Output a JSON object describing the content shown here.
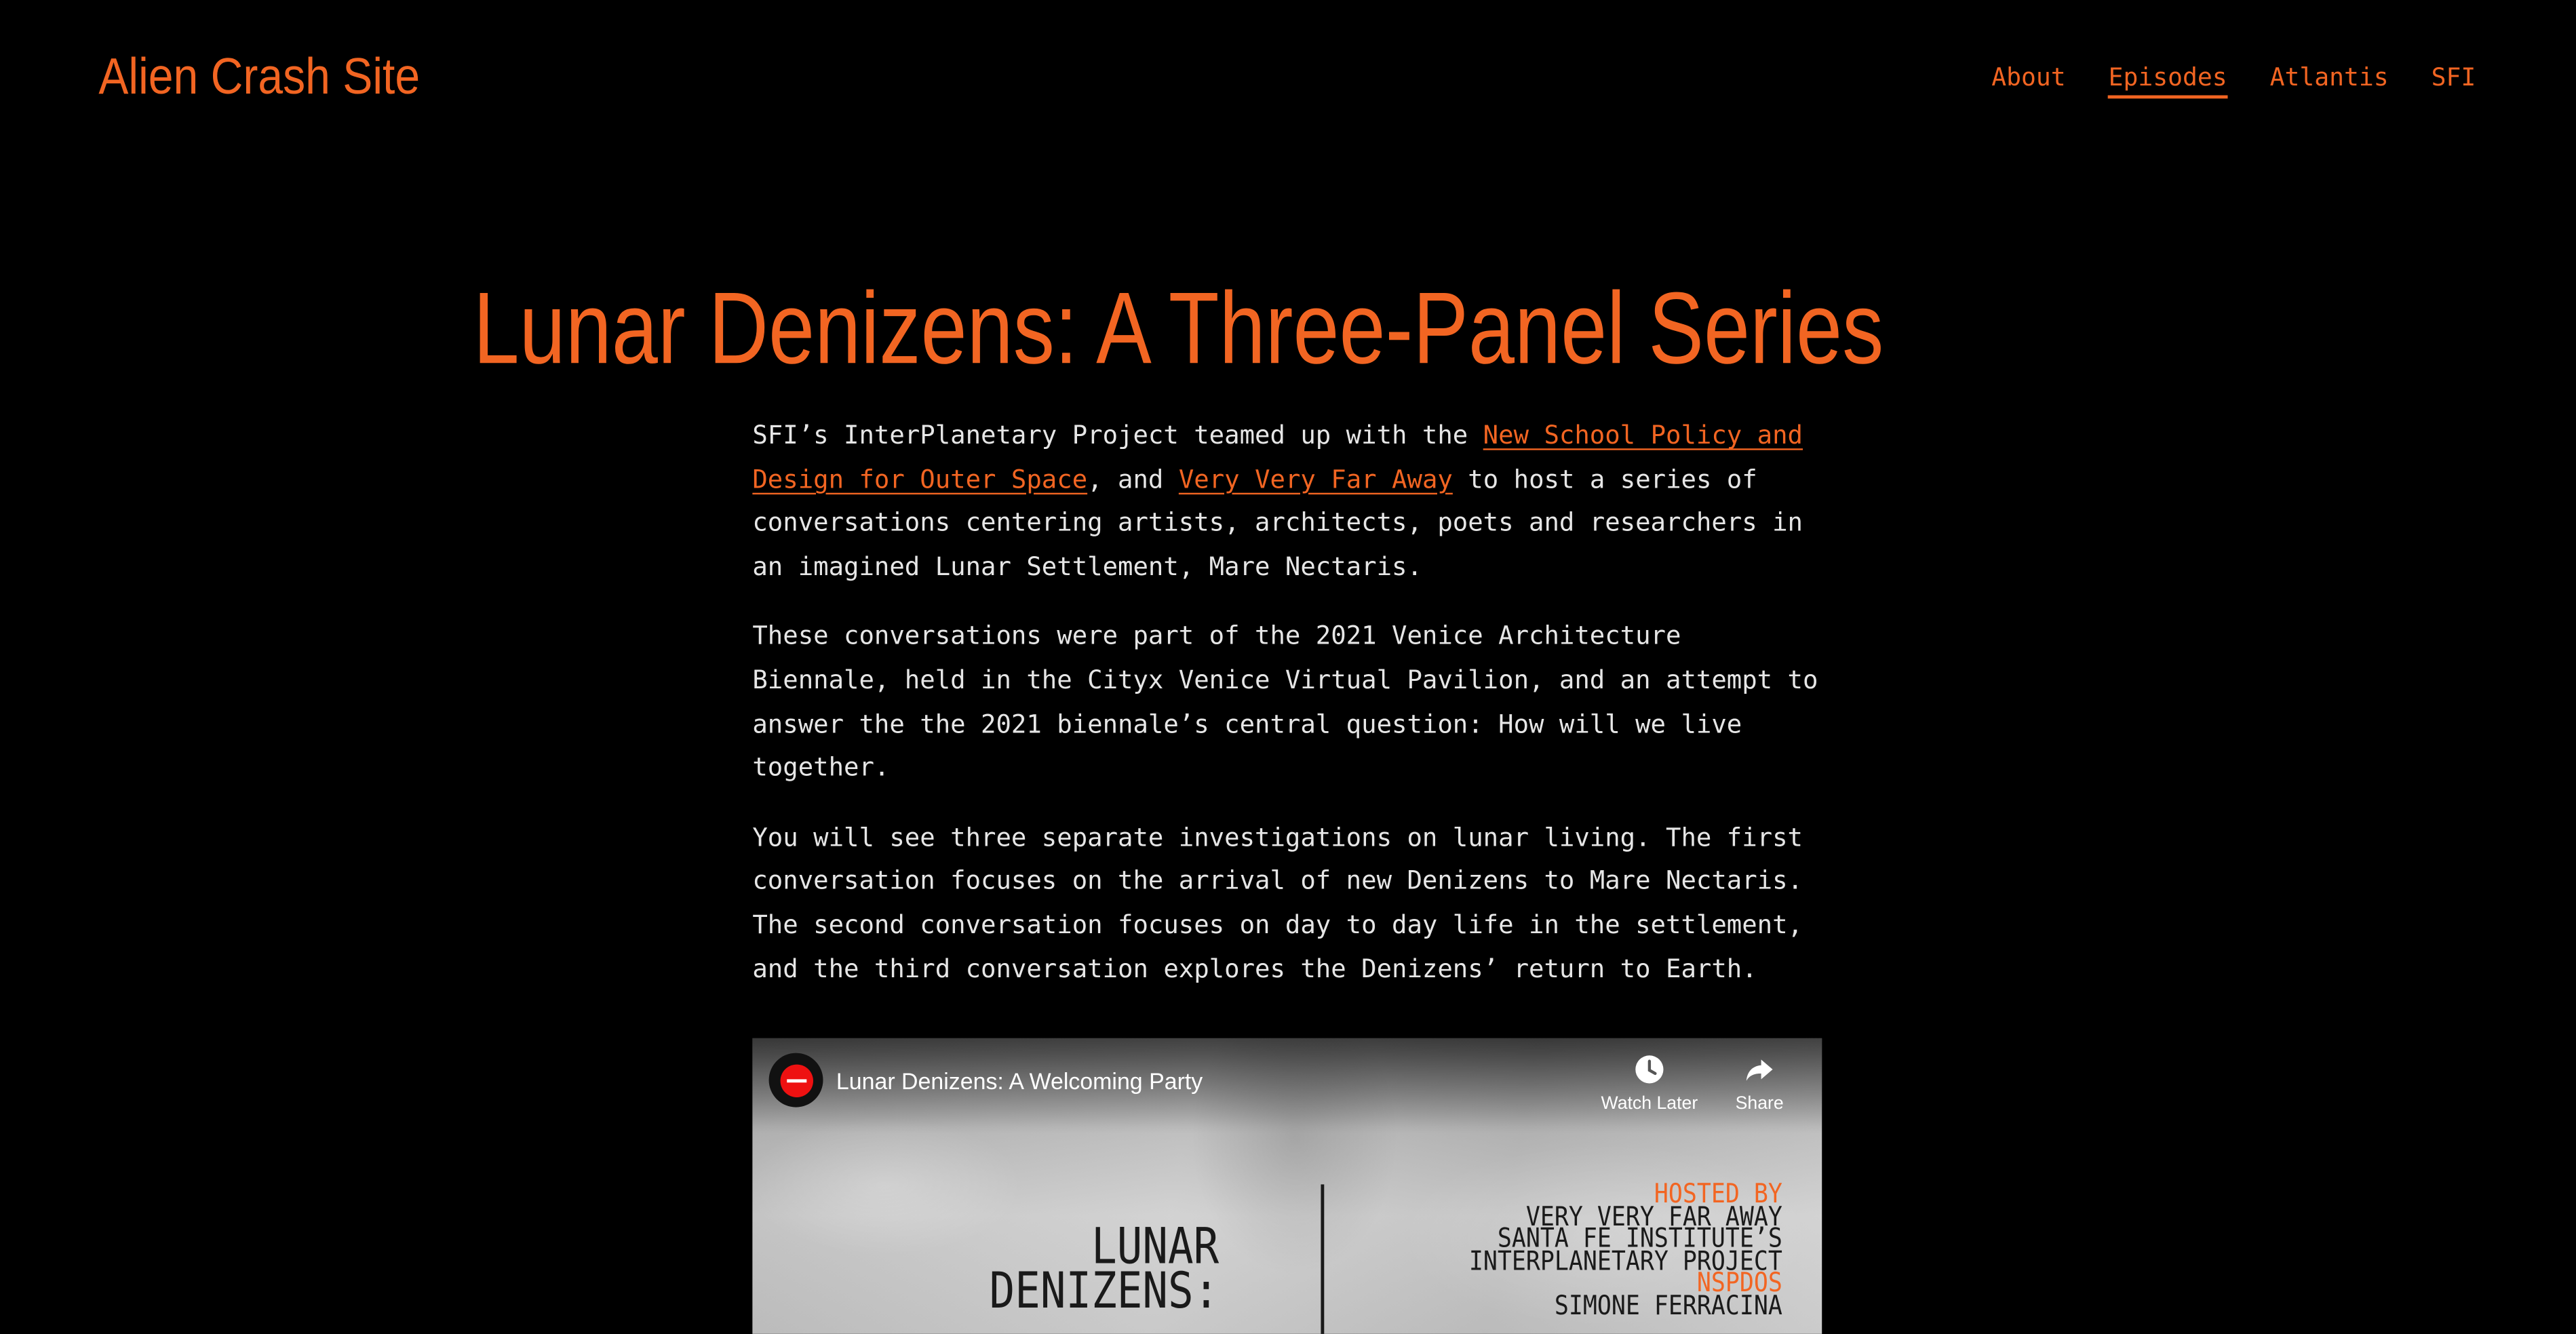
{
  "site": {
    "brand": "Alien Crash Site"
  },
  "nav": {
    "items": [
      {
        "label": "About"
      },
      {
        "label": "Episodes"
      },
      {
        "label": "Atlantis"
      },
      {
        "label": "SFI"
      }
    ],
    "active": "Episodes"
  },
  "article": {
    "title": "Lunar Denizens: A Three-Panel Series",
    "p1": {
      "text_before": "SFI’s InterPlanetary Project teamed up with the ",
      "link1": "New School Policy and Design for Outer Space",
      "text_mid": ", and ",
      "link2": "Very Very Far Away",
      "text_after": " to host a series of conversations centering artists, architects, poets and researchers in an imagined Lunar Settlement, Mare Nectaris."
    },
    "p2": "These conversations were part of the 2021 Venice Architecture Biennale, held in the Cityx Venice Virtual Pavilion, and an attempt to answer the the 2021 biennale’s central question: How will we live together.",
    "p3": "You will see three separate investigations on lunar living. The first conversation focuses on the arrival of new Denizens to Mare Nectaris. The second conversation focuses on day to day life in the settlement, and the third conversation explores the Denizens’ return to Earth."
  },
  "video": {
    "title": "Lunar Denizens: A Welcoming Party",
    "watch_later": "Watch Later",
    "share": "Share",
    "poster_line1": "LUNAR",
    "poster_line2": "DENIZENS:",
    "credits": {
      "hosted_by": "HOSTED BY",
      "line1": "VERY VERY FAR AWAY",
      "line2": "SANTA FE INSTITUTE’S",
      "line3": "INTERPLANETARY PROJECT",
      "nspdos": "NSPDOS",
      "line4": "SIMONE FERRACINA"
    },
    "icons": [
      "clock-icon",
      "share-arrow-icon",
      "channel-avatar"
    ]
  },
  "colors": {
    "accent": "#f26522",
    "background": "#000000",
    "text": "#e6e6e6"
  }
}
